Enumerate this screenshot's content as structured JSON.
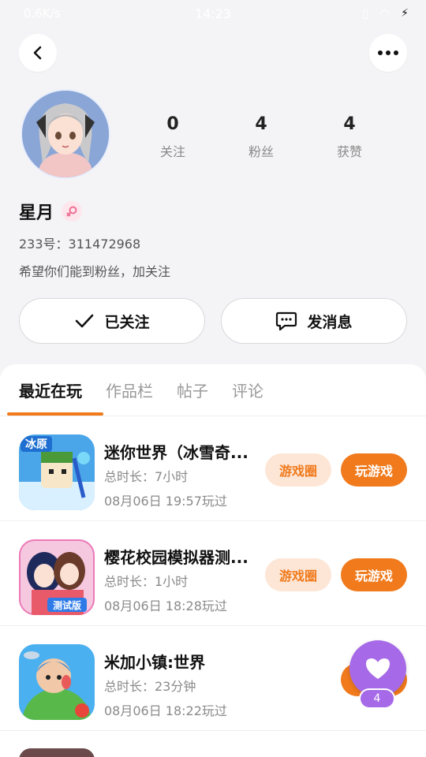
{
  "status_bar": {
    "speed": "0.6K/s",
    "time": "14:23"
  },
  "profile": {
    "name": "星月",
    "uid": "233号：311472968",
    "bio": "希望你们能到粉丝，加关注",
    "stats": [
      {
        "value": "0",
        "label": "关注"
      },
      {
        "value": "4",
        "label": "粉丝"
      },
      {
        "value": "4",
        "label": "获赞"
      }
    ]
  },
  "actions": {
    "follow_label": "已关注",
    "message_label": "发消息"
  },
  "tabs": [
    "最近在玩",
    "作品栏",
    "帖子",
    "评论"
  ],
  "games": [
    {
      "title": "迷你世界（冰雪奇...",
      "duration": "总时长：7小时",
      "last_played": "08月06日 19:57玩过",
      "circle_label": "游戏圈",
      "play_label": "玩游戏",
      "icon_text": "冰原"
    },
    {
      "title": "樱花校园模拟器测...",
      "duration": "总时长：1小时",
      "last_played": "08月06日 18:28玩过",
      "circle_label": "游戏圈",
      "play_label": "玩游戏",
      "icon_text": "测试版"
    },
    {
      "title": "米加小镇:世界",
      "duration": "总时长：23分钟",
      "last_played": "08月06日 18:22玩过",
      "circle_label": "",
      "play_label": "",
      "icon_text": ""
    }
  ],
  "floating_like": {
    "count": "4"
  },
  "colors": {
    "accent": "#f07a1c",
    "accent_light": "#fde6d6",
    "purple": "#a66ae8"
  }
}
